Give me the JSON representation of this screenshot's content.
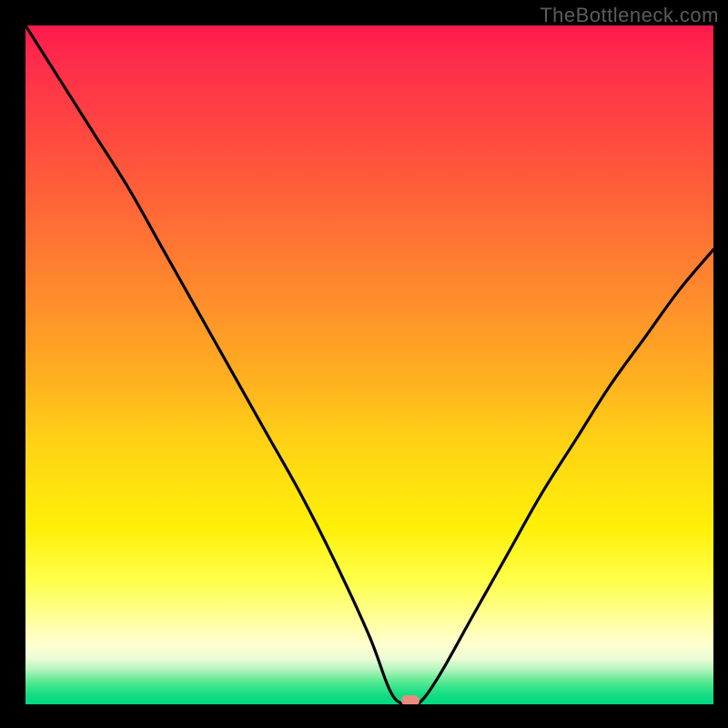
{
  "watermark": "TheBottleneck.com",
  "chart_data": {
    "type": "line",
    "title": "",
    "xlabel": "",
    "ylabel": "",
    "xlim": [
      0,
      100
    ],
    "ylim": [
      0,
      100
    ],
    "grid": false,
    "legend": false,
    "series": [
      {
        "name": "bottleneck-curve",
        "x": [
          0,
          5,
          10,
          15,
          20,
          25,
          30,
          35,
          40,
          45,
          50,
          53,
          55,
          57,
          60,
          65,
          70,
          75,
          80,
          85,
          90,
          95,
          100
        ],
        "values": [
          100,
          92,
          84,
          76,
          67,
          58,
          49,
          40,
          31,
          21,
          10,
          2,
          0,
          0,
          4,
          13,
          22,
          31,
          39,
          47,
          54,
          61,
          67
        ]
      }
    ],
    "annotations": [
      {
        "name": "optimal-marker",
        "x": 56,
        "y": 0.5
      }
    ],
    "background_gradient": {
      "stops": [
        {
          "pos": 0,
          "color": "#ff1a4d"
        },
        {
          "pos": 40,
          "color": "#ff8c2c"
        },
        {
          "pos": 74,
          "color": "#fff008"
        },
        {
          "pos": 91,
          "color": "#ffffcf"
        },
        {
          "pos": 100,
          "color": "#00d77f"
        }
      ]
    }
  }
}
